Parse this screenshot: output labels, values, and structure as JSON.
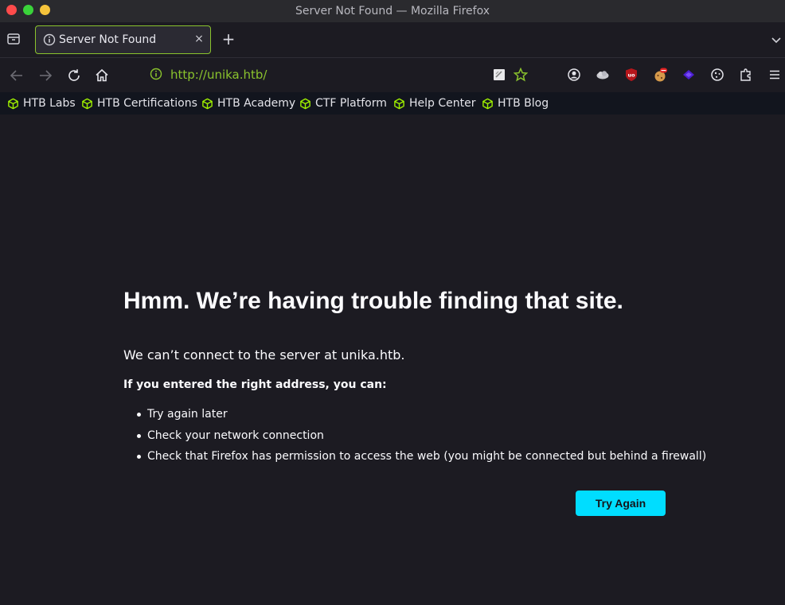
{
  "window": {
    "title": "Server Not Found — Mozilla Firefox"
  },
  "tab": {
    "title": "Server Not Found",
    "close_glyph": "×"
  },
  "tabstrip": {
    "new_tab_glyph": "+"
  },
  "navbar": {
    "url": "http://unika.htb/"
  },
  "bookmarks": [
    {
      "label": "HTB Labs"
    },
    {
      "label": "HTB Certifications"
    },
    {
      "label": "HTB Academy"
    },
    {
      "label": "CTF Platform"
    },
    {
      "label": "Help Center"
    },
    {
      "label": "HTB Blog"
    }
  ],
  "error": {
    "title": "Hmm. We’re having trouble finding that site.",
    "description": "We can’t connect to the server at unika.htb.",
    "subheading": "If you entered the right address, you can:",
    "suggestions": [
      "Try again later",
      "Check your network connection",
      "Check that Firefox has permission to access the web (you might be connected but behind a firewall)"
    ],
    "button_label": "Try Again"
  },
  "colors": {
    "accent_green": "#8ac32d",
    "try_again_button": "#00ddff",
    "page_background": "#1c1b22",
    "bookmarks_background": "#12151e"
  },
  "icons": {
    "toolbar": [
      "list-all-tabs-icon",
      "info-icon",
      "back-arrow-icon",
      "forward-arrow-icon",
      "reload-icon",
      "home-icon",
      "page-note-icon",
      "bookmark-star-icon",
      "account-icon",
      "cloud-extension-icon",
      "ublock-icon",
      "cookie-extension-icon",
      "wappalyzer-icon",
      "cookie-icon",
      "extensions-puzzle-icon",
      "hamburger-menu-icon",
      "chevron-down-icon"
    ],
    "bookmark": "htb-cube-icon"
  }
}
